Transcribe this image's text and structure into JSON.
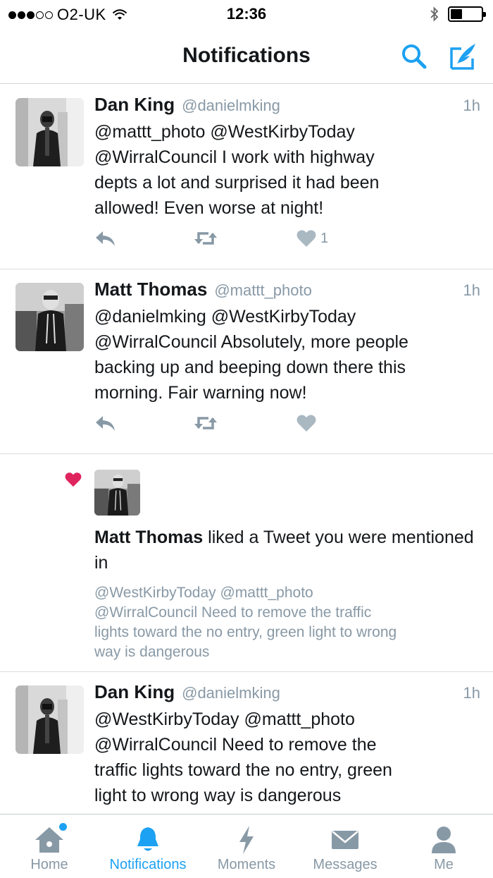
{
  "status_bar": {
    "carrier": "O2-UK",
    "time": "12:36"
  },
  "nav": {
    "title": "Notifications"
  },
  "tweets": [
    {
      "name": "Dan King",
      "handle": "@danielmking",
      "time": "1h",
      "text": "@mattt_photo @WestKirbyToday\n@WirralCouncil I work with highway\ndepts a lot and surprised it had been\nallowed! Even worse at night!",
      "likes": "1"
    },
    {
      "name": "Matt Thomas",
      "handle": "@mattt_photo",
      "time": "1h",
      "text": "@danielmking @WestKirbyToday\n@WirralCouncil Absolutely, more people\nbacking up and beeping down there this\nmorning. Fair warning now!"
    }
  ],
  "like_notification": {
    "actor": "Matt Thomas",
    "action_text": " liked a Tweet you were mentioned in",
    "liked_tweet": "@WestKirbyToday @mattt_photo\n@WirralCouncil Need to remove the traffic\nlights toward the no entry, green light to wrong\nway is dangerous"
  },
  "last_tweet": {
    "name": "Dan King",
    "handle": "@danielmking",
    "time": "1h",
    "text": "@WestKirbyToday @mattt_photo\n@WirralCouncil Need to remove the\ntraffic lights toward the no entry, green\nlight to wrong way is dangerous"
  },
  "tabs": [
    {
      "label": "Home",
      "icon": "home-icon"
    },
    {
      "label": "Notifications",
      "icon": "bell-icon"
    },
    {
      "label": "Moments",
      "icon": "lightning-icon"
    },
    {
      "label": "Messages",
      "icon": "envelope-icon"
    },
    {
      "label": "Me",
      "icon": "person-icon"
    }
  ],
  "colors": {
    "accent": "#1da1f2",
    "muted": "#8899a6",
    "like_red": "#e0245e"
  }
}
